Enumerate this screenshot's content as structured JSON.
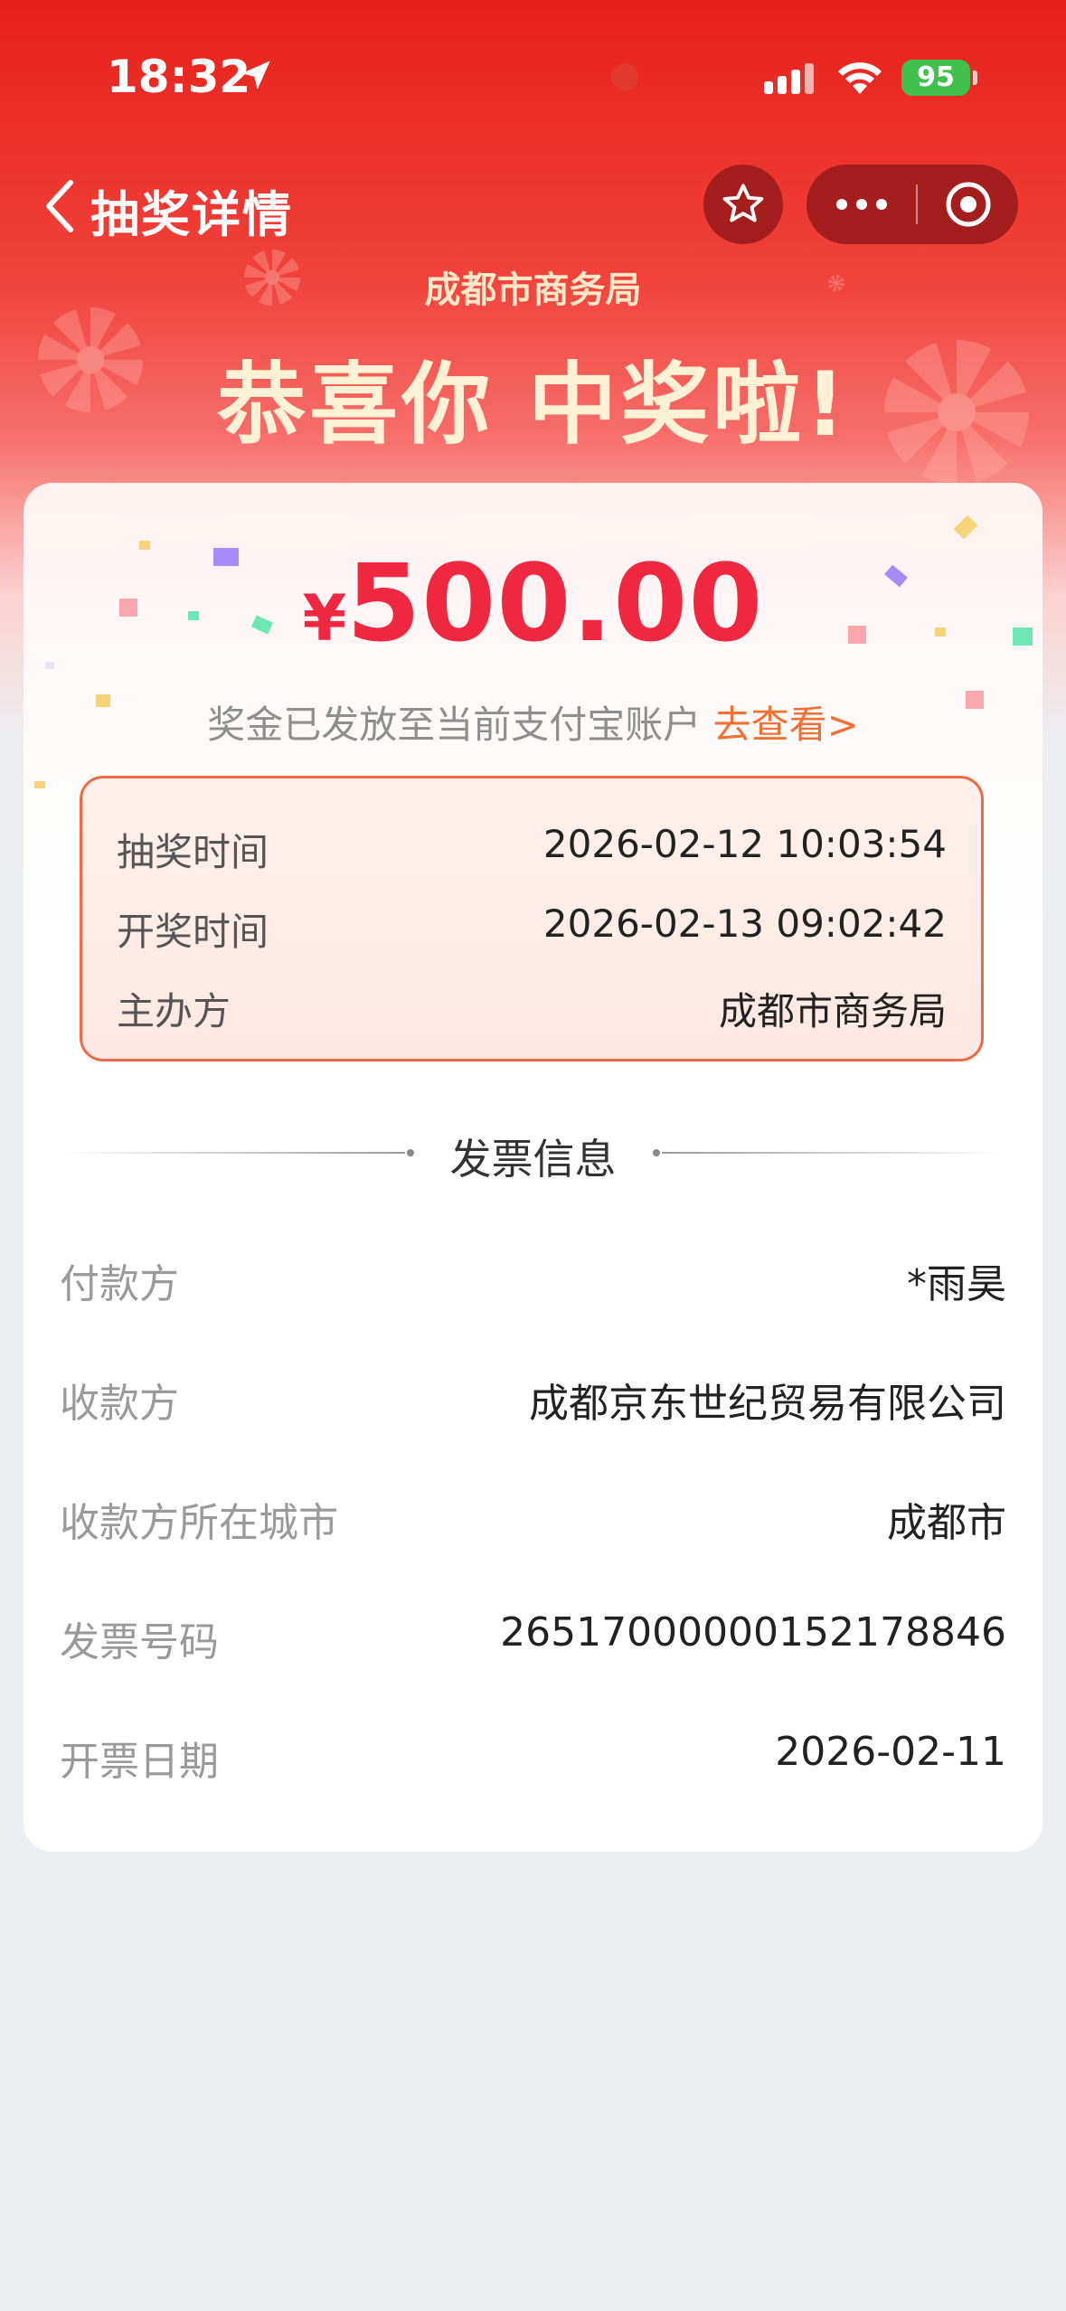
{
  "status_bar": {
    "time": "18:32",
    "battery": "95"
  },
  "nav": {
    "title": "抽奖详情"
  },
  "header": {
    "organizer": "成都市商务局",
    "congrats": "恭喜你 中奖啦!"
  },
  "prize": {
    "currency": "¥",
    "amount": "500.00",
    "notice": "奖金已发放至当前支付宝账户",
    "view_link": "去查看>"
  },
  "lottery_info": [
    {
      "label": "抽奖时间",
      "value": "2026-02-12 10:03:54"
    },
    {
      "label": "开奖时间",
      "value": "2026-02-13 09:02:42"
    },
    {
      "label": "主办方",
      "value": "成都市商务局"
    }
  ],
  "invoice": {
    "section_title": "发票信息",
    "rows": [
      {
        "label": "付款方",
        "value": "*雨昊"
      },
      {
        "label": "收款方",
        "value": "成都京东世纪贸易有限公司"
      },
      {
        "label": "收款方所在城市",
        "value": "成都市"
      },
      {
        "label": "发票号码",
        "value": "26517000000152178846"
      },
      {
        "label": "开票日期",
        "value": "2026-02-11"
      }
    ]
  },
  "colors": {
    "header_red": "#e8201b",
    "amount_red": "#ef2740",
    "link_orange": "#f27035"
  }
}
